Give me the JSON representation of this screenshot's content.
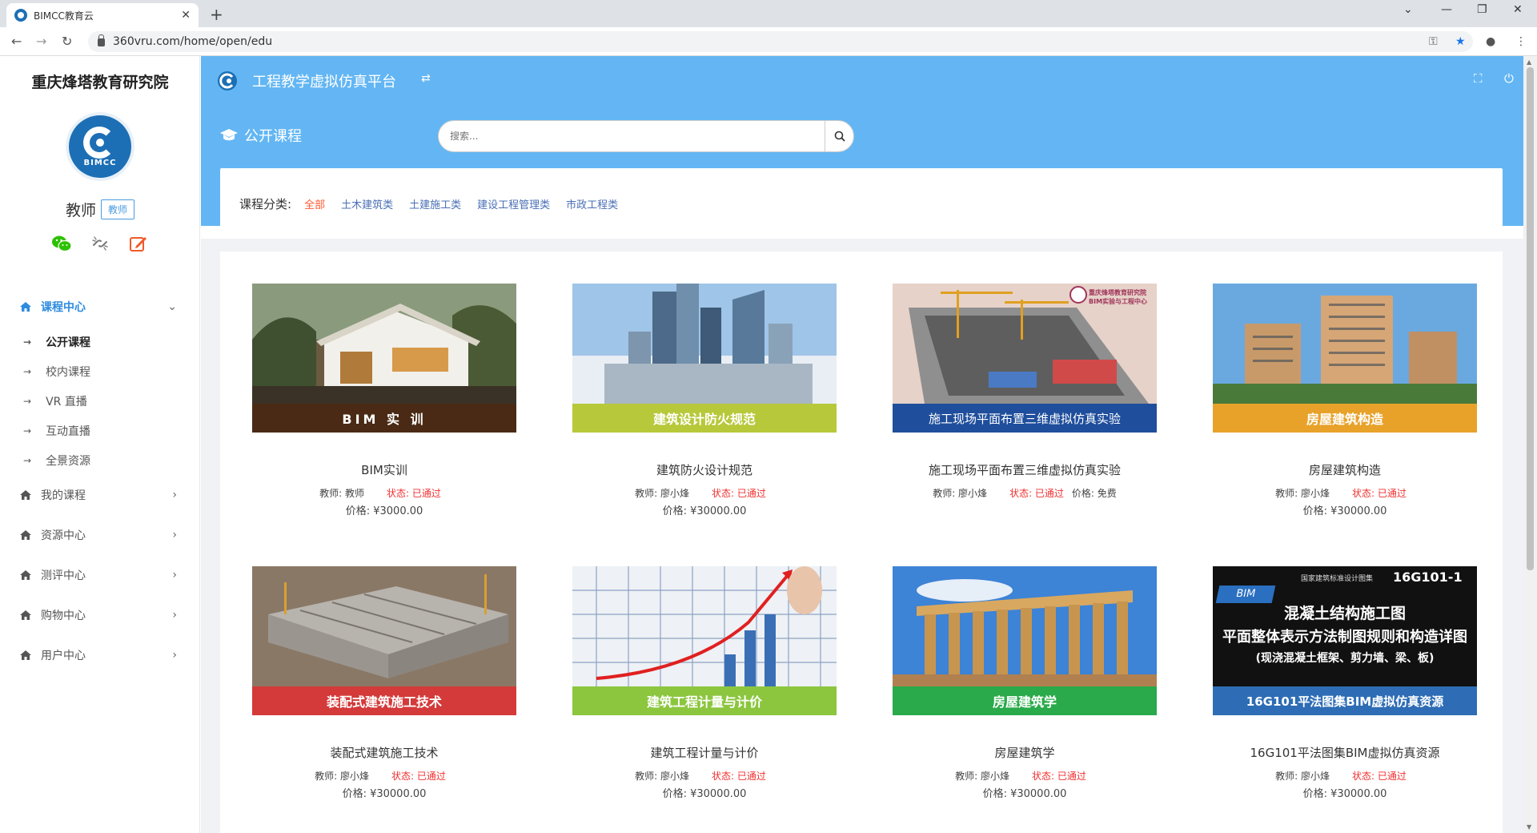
{
  "browser": {
    "tab_title": "BIMCC教育云",
    "tab_close": "✕",
    "new_tab": "+",
    "url": "360vru.com/home/open/edu"
  },
  "sidebar": {
    "org_name": "重庆烽塔教育研究院",
    "logo_text": "BIMCC",
    "role_name": "教师",
    "role_badge": "教师",
    "menu": [
      {
        "label": "课程中心",
        "chevron": "⌄",
        "active": true
      },
      {
        "label": "我的课程",
        "chevron": "›"
      },
      {
        "label": "资源中心",
        "chevron": "›"
      },
      {
        "label": "测评中心",
        "chevron": "›"
      },
      {
        "label": "购物中心",
        "chevron": "›"
      },
      {
        "label": "用户中心",
        "chevron": "›"
      }
    ],
    "submenu": [
      {
        "label": "公开课程",
        "active": true
      },
      {
        "label": "校内课程"
      },
      {
        "label": "VR 直播"
      },
      {
        "label": "互动直播"
      },
      {
        "label": "全景资源"
      }
    ],
    "sub_arrow": "→"
  },
  "header": {
    "title": "工程教学虚拟仿真平台",
    "swap_icon": "⇄",
    "fullscreen_icon": "⛶",
    "power_icon": "⏻"
  },
  "page": {
    "title": "公开课程",
    "search_placeholder": "搜索..."
  },
  "categories": {
    "label": "课程分类:",
    "items": [
      "全部",
      "土木建筑类",
      "土建施工类",
      "建设工程管理类",
      "市政工程类"
    ],
    "active_index": 0
  },
  "courses": [
    {
      "name": "BIM实训",
      "band": "BIM 实 训",
      "band_color": "#4a2a14",
      "teacher": "教师:  教师",
      "status": "状态:  已通过",
      "extra": "",
      "price": "价格:  ¥3000.00"
    },
    {
      "name": "建筑防火设计规范",
      "band": "建筑设计防火规范",
      "band_color": "#b7c83a",
      "teacher": "教师:  廖小烽",
      "status": "状态:  已通过",
      "extra": "",
      "price": "价格:  ¥30000.00"
    },
    {
      "name": "施工现场平面布置三维虚拟仿真实验",
      "band": "施工现场平面布置三维虚拟仿真实验",
      "band_color": "#1f4e9c",
      "teacher": "教师:  廖小烽",
      "status": "状态:  已通过",
      "extra": "价格:  免费",
      "price": ""
    },
    {
      "name": "房屋建筑构造",
      "band": "房屋建筑构造",
      "band_color": "#e8a22a",
      "teacher": "教师:  廖小烽",
      "status": "状态:  已通过",
      "extra": "",
      "price": "价格:  ¥30000.00"
    },
    {
      "name": "装配式建筑施工技术",
      "band": "装配式建筑施工技术",
      "band_color": "#d43a3a",
      "teacher": "教师:  廖小烽",
      "status": "状态:  已通过",
      "extra": "",
      "price": "价格:  ¥30000.00"
    },
    {
      "name": "建筑工程计量与计价",
      "band": "建筑工程计量与计价",
      "band_color": "#8cc63f",
      "teacher": "教师:  廖小烽",
      "status": "状态:  已通过",
      "extra": "",
      "price": "价格:  ¥30000.00"
    },
    {
      "name": "房屋建筑学",
      "band": "房屋建筑学",
      "band_color": "#2aaa4a",
      "teacher": "教师:  廖小烽",
      "status": "状态:  已通过",
      "extra": "",
      "price": "价格:  ¥30000.00"
    },
    {
      "name": "16G101平法图集BIM虚拟仿真资源",
      "band": "16G101平法图集BIM虚拟仿真资源",
      "band_color": "#2e6db5",
      "teacher": "教师:  廖小烽",
      "status": "状态:  已通过",
      "extra": "",
      "price": "价格:  ¥30000.00"
    }
  ],
  "thumb_text": {
    "c3_stamp": "重庆烽塔教育研究院 BIM实验与工程中心",
    "c8_header": "国家建筑标准设计图集",
    "c8_code": "16G101-1",
    "c8_ribbon": "BIM",
    "c8_line1": "混凝土结构施工图",
    "c8_line2": "平面整体表示方法制图规则和构造详图",
    "c8_line3": "(现浇混凝土框架、剪力墙、梁、板)"
  },
  "colors": {
    "header_blue": "#63b6f3",
    "accent_blue": "#2e8be0",
    "active_category": "#ff5a33",
    "status_red": "#f23030",
    "wechat_green": "#2dc100",
    "edit_orange": "#f05a28"
  }
}
